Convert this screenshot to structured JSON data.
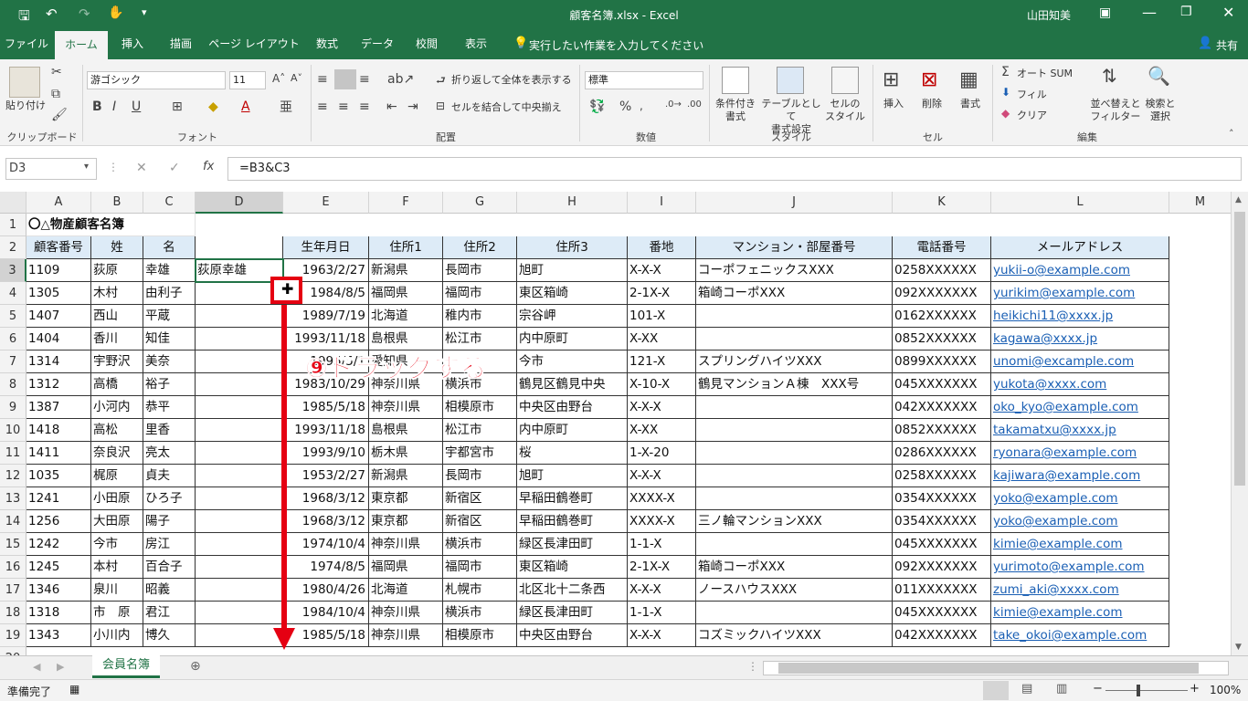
{
  "window": {
    "title": "顧客名簿.xlsx  -  Excel",
    "user": "山田知美"
  },
  "tabs": [
    "ファイル",
    "ホーム",
    "挿入",
    "描画",
    "ページ レイアウト",
    "数式",
    "データ",
    "校閲",
    "表示"
  ],
  "tell_me": "実行したい作業を入力してください",
  "share": "共有",
  "ribbon": {
    "paste": "貼り付け",
    "clipboard": "クリップボード",
    "font_name": "游ゴシック",
    "font_size": "11",
    "font": "フォント",
    "wrap": "折り返して全体を表示する",
    "merge": "セルを結合して中央揃え",
    "alignment": "配置",
    "number_format": "標準",
    "number": "数値",
    "cond_format": "条件付き\n書式",
    "table_format": "テーブルとして\n書式設定",
    "cell_style": "セルの\nスタイル",
    "styles": "スタイル",
    "insert": "挿入",
    "delete": "削除",
    "format": "書式",
    "cells": "セル",
    "autosum": "オート SUM",
    "fill": "フィル",
    "clear": "クリア",
    "sort": "並べ替えと\nフィルター",
    "find": "検索と\n選択",
    "editing": "編集"
  },
  "formula_bar": {
    "name_box": "D3",
    "formula": "=B3&C3"
  },
  "columns": [
    "A",
    "B",
    "C",
    "D",
    "E",
    "F",
    "G",
    "H",
    "I",
    "J",
    "K",
    "L",
    "M"
  ],
  "title_cell": "〇△物産顧客名簿",
  "headers": [
    "顧客番号",
    "姓",
    "名",
    "",
    "生年月日",
    "住所1",
    "住所2",
    "住所3",
    "番地",
    "マンション・部屋番号",
    "電話番号",
    "メールアドレス"
  ],
  "rows": [
    [
      "3",
      "1109",
      "荻原",
      "幸雄",
      "荻原幸雄",
      "1963/2/27",
      "新潟県",
      "長岡市",
      "旭町",
      "X-X-X",
      "コーポフェニックスXXX",
      "0258XXXXXX",
      "yukii-o@example.com"
    ],
    [
      "4",
      "1305",
      "木村",
      "由利子",
      "",
      "1984/8/5",
      "福岡県",
      "福岡市",
      "東区箱崎",
      "2-1X-X",
      "箱崎コーポXXX",
      "092XXXXXXX",
      "yurikim@example.com"
    ],
    [
      "5",
      "1407",
      "西山",
      "平蔵",
      "",
      "1989/7/19",
      "北海道",
      "稚内市",
      "宗谷岬",
      "101-X",
      "",
      "0162XXXXXX",
      "heikichi11@xxxx.jp"
    ],
    [
      "6",
      "1404",
      "香川",
      "知佳",
      "",
      "1993/11/18",
      "島根県",
      "松江市",
      "内中原町",
      "X-XX",
      "",
      "0852XXXXXX",
      "kagawa@xxxx.jp"
    ],
    [
      "7",
      "1314",
      "宇野沢",
      "美奈",
      "",
      "1995/5/1",
      "愛知県",
      "",
      "今市",
      "121-X",
      "スプリングハイツXXX",
      "0899XXXXXX",
      "unomi@excample.com"
    ],
    [
      "8",
      "1312",
      "高橋",
      "裕子",
      "",
      "1983/10/29",
      "神奈川県",
      "横浜市",
      "鶴見区鶴見中央",
      "X-10-X",
      "鶴見マンションＡ棟　XXX号",
      "045XXXXXXX",
      "yukota@xxxx.com"
    ],
    [
      "9",
      "1387",
      "小河内",
      "恭平",
      "",
      "1985/5/18",
      "神奈川県",
      "相模原市",
      "中央区由野台",
      "X-X-X",
      "",
      "042XXXXXXX",
      "oko_kyo@example.com"
    ],
    [
      "10",
      "1418",
      "高松",
      "里香",
      "",
      "1993/11/18",
      "島根県",
      "松江市",
      "内中原町",
      "X-XX",
      "",
      "0852XXXXXX",
      "takamatxu@xxxx.jp"
    ],
    [
      "11",
      "1411",
      "奈良沢",
      "亮太",
      "",
      "1993/9/10",
      "栃木県",
      "宇都宮市",
      "桜",
      "1-X-20",
      "",
      "0286XXXXXX",
      "ryonara@example.com"
    ],
    [
      "12",
      "1035",
      "梶原",
      "貞夫",
      "",
      "1953/2/27",
      "新潟県",
      "長岡市",
      "旭町",
      "X-X-X",
      "",
      "0258XXXXXX",
      "kajiwara@example.com"
    ],
    [
      "13",
      "1241",
      "小田原",
      "ひろ子",
      "",
      "1968/3/12",
      "東京都",
      "新宿区",
      "早稲田鶴巻町",
      "XXXX-X",
      "",
      "0354XXXXXX",
      "yoko@example.com"
    ],
    [
      "14",
      "1256",
      "大田原",
      "陽子",
      "",
      "1968/3/12",
      "東京都",
      "新宿区",
      "早稲田鶴巻町",
      "XXXX-X",
      "三ノ輪マンションXXX",
      "0354XXXXXX",
      "yoko@example.com"
    ],
    [
      "15",
      "1242",
      "今市",
      "房江",
      "",
      "1974/10/4",
      "神奈川県",
      "横浜市",
      "緑区長津田町",
      "1-1-X",
      "",
      "045XXXXXXX",
      "kimie@example.com"
    ],
    [
      "16",
      "1245",
      "本村",
      "百合子",
      "",
      "1974/8/5",
      "福岡県",
      "福岡市",
      "東区箱崎",
      "2-1X-X",
      "箱崎コーポXXX",
      "092XXXXXXX",
      "yurimoto@example.com"
    ],
    [
      "17",
      "1346",
      "泉川",
      "昭義",
      "",
      "1980/4/26",
      "北海道",
      "札幌市",
      "北区北十二条西",
      "X-X-X",
      "ノースハウスXXX",
      "011XXXXXXX",
      "zumi_aki@xxxx.com"
    ],
    [
      "18",
      "1318",
      "市　原",
      "君江",
      "",
      "1984/10/4",
      "神奈川県",
      "横浜市",
      "緑区長津田町",
      "1-1-X",
      "",
      "045XXXXXXX",
      "kimie@example.com"
    ],
    [
      "19",
      "1343",
      "小川内",
      "博久",
      "",
      "1985/5/18",
      "神奈川県",
      "相模原市",
      "中央区由野台",
      "X-X-X",
      "コズミックハイツXXX",
      "042XXXXXXX",
      "take_okoi@example.com"
    ]
  ],
  "annotation": "⑨ドラッグする",
  "sheet_tab": "会員名簿",
  "status": "準備完了",
  "zoom": "100%",
  "accent": "#217346",
  "annotation_color": "#e50012"
}
